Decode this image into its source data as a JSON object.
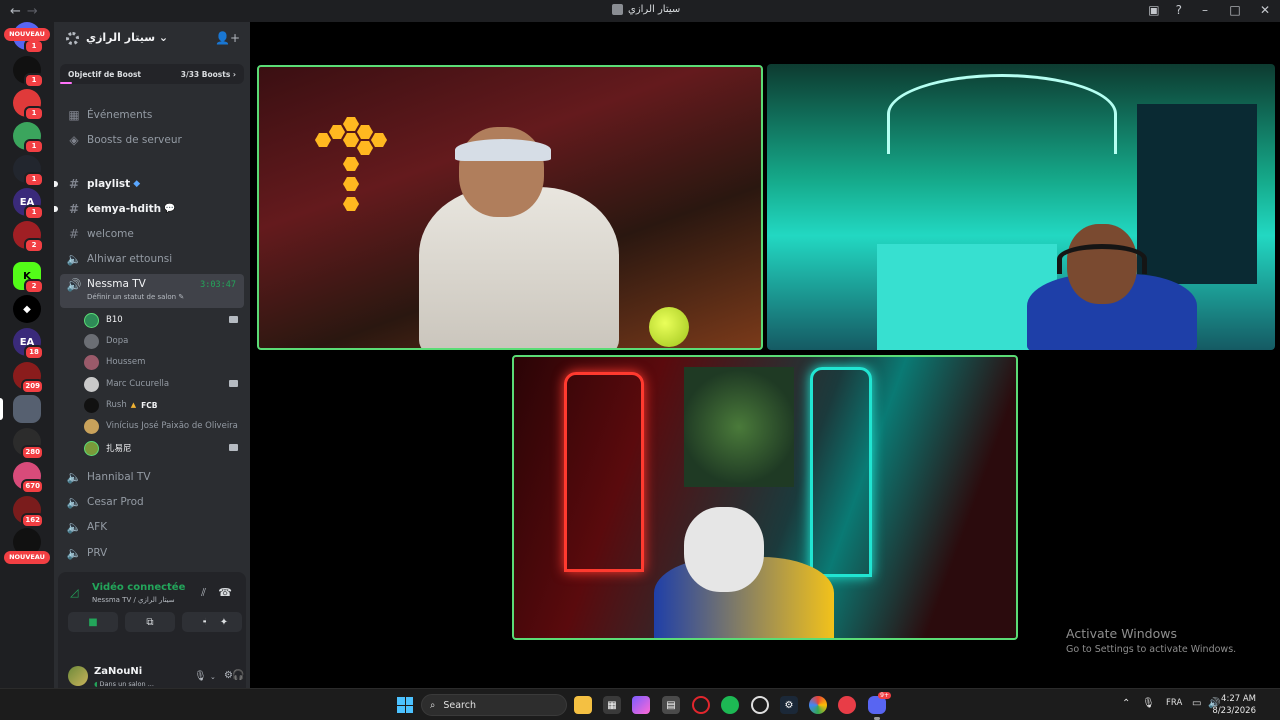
{
  "window": {
    "title": "سيتار الرازي"
  },
  "rail": {
    "nouveau_label": "NOUVEAU",
    "servers": [
      {
        "badge": "1"
      },
      {
        "badge": "1"
      },
      {
        "badge": "1"
      },
      {
        "badge": "1"
      },
      {
        "badge": "1"
      },
      {
        "badge": "1"
      },
      {
        "badge": "2"
      },
      {
        "badge": "2"
      },
      {
        "badge": ""
      },
      {
        "badge": "18"
      },
      {
        "badge": "209"
      },
      {
        "badge": ""
      },
      {
        "badge": "280"
      },
      {
        "badge": "670"
      },
      {
        "badge": "162"
      },
      {
        "badge": ""
      }
    ]
  },
  "sidebar": {
    "server_name": "سيتار الرازي",
    "boost_goal_label": "Objectif de Boost",
    "boost_count": "3/33 Boosts",
    "events_label": "Événements",
    "server_boosts_label": "Boosts de serveur",
    "channels": [
      {
        "name": "playlist"
      },
      {
        "name": "kemya-hdith"
      },
      {
        "name": "welcome"
      },
      {
        "name": "Alhiwar ettounsi"
      }
    ],
    "active_voice": {
      "name": "Nessma TV",
      "timer": "3:03:47",
      "status_prompt": "Définir un statut de salon"
    },
    "members": [
      {
        "name": "B10"
      },
      {
        "name": "Dopa"
      },
      {
        "name": "Houssem"
      },
      {
        "name": "Marc Cucurella"
      },
      {
        "name": "Rush",
        "tag": "FCB"
      },
      {
        "name": "Vinícius José Paixão de Oliveira"
      },
      {
        "name": "扎易尼"
      }
    ],
    "voice_channels": [
      {
        "name": "Hannibal TV"
      },
      {
        "name": "Cesar Prod"
      },
      {
        "name": "AFK"
      },
      {
        "name": "PRV"
      }
    ]
  },
  "voice_panel": {
    "title": "Vidéo connectée",
    "subtitle": "Nessma TV / سيتار الرازي"
  },
  "user": {
    "name": "ZaNouNi",
    "status": "Dans un salon ..."
  },
  "activation": {
    "line1": "Activate Windows",
    "line2": "Go to Settings to activate Windows."
  },
  "taskbar": {
    "search_label": "Search",
    "lang": "FRA",
    "time": "4:27 AM",
    "date": "8/23/2026",
    "discord_badge": "9+"
  },
  "colors": {
    "accent_green": "#23a55a",
    "speaking_border": "#5bdc76",
    "danger_red": "#f23f43"
  }
}
